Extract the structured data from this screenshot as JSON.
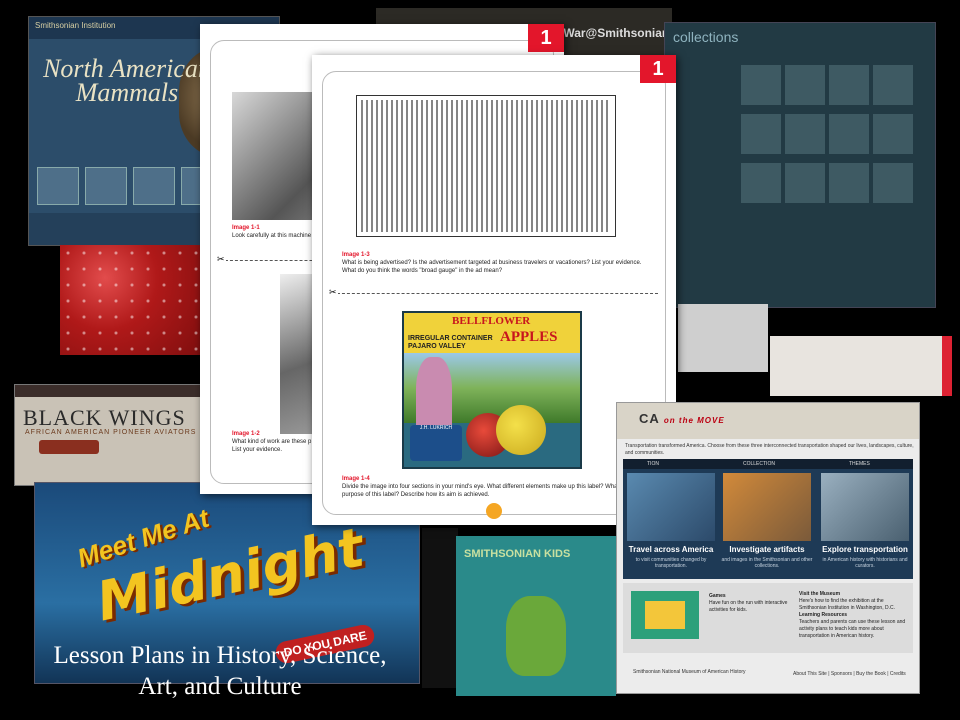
{
  "collage": {
    "mammals": {
      "logo": "Smithsonian Institution",
      "title": "North American Mammals"
    },
    "black_wings": {
      "title": "BLACK WINGS",
      "subtitle": "AFRICAN AMERICAN PIONEER AVIATORS"
    },
    "midnight": {
      "meet": "Meet Me At",
      "midnight": "Midnight",
      "dare": "DO YOU DARE"
    },
    "civil_war": {
      "title": "dWar@Smithsonian"
    },
    "collections": {
      "title": "collections"
    },
    "kids": {
      "title": "SMITHSONIAN KIDS"
    }
  },
  "worksheet_a": {
    "badge": "1",
    "image_1_1": {
      "label": "Image 1-1",
      "text": "Look carefully at this machine"
    },
    "image_1_2": {
      "label": "Image 1-2",
      "text": "What kind of work are these p List your evidence."
    }
  },
  "worksheet_b": {
    "badge": "1",
    "image_1_3": {
      "label": "Image 1-3",
      "text": "What is being advertised? Is the advertisement targeted at business travelers or vacationers? List your evidence. What do you think the words \"broad gauge\" in the ad mean?"
    },
    "apple_label": {
      "irregular": "IRREGULAR CONTAINER",
      "bellflower": "BELLFLOWER",
      "apples": "APPLES",
      "valley": "PAJARO VALLEY",
      "grower": "J.H. LUKRICH"
    },
    "image_1_4": {
      "label": "Image 1-4",
      "text": "Divide the image into four sections in your mind's eye. What different elements make up this label? What is the purpose of this label? Describe how its aim is achieved."
    }
  },
  "america_on_the_move": {
    "logo": "CA",
    "logo_tag": "on the MOVE",
    "intro": "Transportation transformed America. Choose from these three interconnected transportation shaped our lives, landscapes, culture, and communities.",
    "tabs": [
      "TION",
      "COLLECTION",
      "THEMES"
    ],
    "panels": [
      {
        "title": "Travel across America",
        "sub": "to visit communities changed by transportation."
      },
      {
        "title": "Investigate artifacts",
        "sub": "and images in the Smithsonian and other collections."
      },
      {
        "title": "Explore transportation",
        "sub": "in American history with historians and curators."
      }
    ],
    "games": {
      "title": "Games",
      "text": "Have fun on the run with interactive activities for kids."
    },
    "visit": {
      "title": "Visit the Museum",
      "text": "Here's how to find the exhibition at the Smithsonian Institution in Washington, D.C."
    },
    "learning": {
      "title": "Learning Resources",
      "text": "Teachers and parents can use these lesson and activity plans to teach kids more about transportation in American history."
    },
    "footer_org": "Smithsonian National Museum of American History",
    "footer_links": "About This Site | Sponsors | Buy the Book | Credits"
  },
  "caption": {
    "line1": "Lesson Plans in History, Science,",
    "line2": "Art, and Culture"
  }
}
